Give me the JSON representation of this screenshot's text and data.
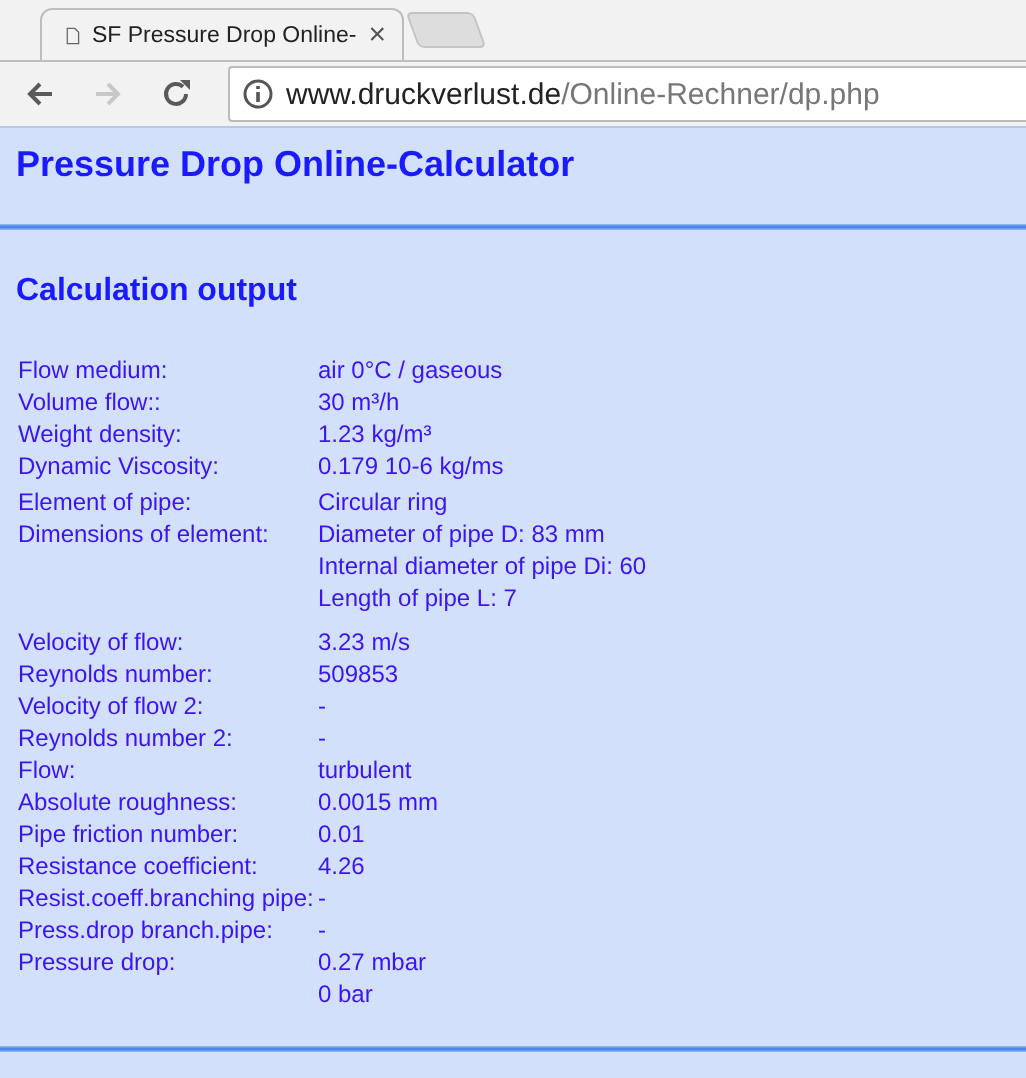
{
  "browser": {
    "tab_title": "SF Pressure Drop Online-",
    "tab_close": "×",
    "nav": [
      {
        "kind": "back",
        "disabled": false
      },
      {
        "kind": "forward",
        "disabled": true
      },
      {
        "kind": "reload",
        "disabled": false
      }
    ],
    "url_host": "www.druckverlust.de",
    "url_path": "/Online-Rechner/dp.php"
  },
  "page": {
    "title": "Pressure Drop Online-Calculator",
    "heading": "Calculation output",
    "groups": [
      {
        "rows": [
          {
            "label": "Flow medium:",
            "values": [
              "air 0°C / gaseous"
            ]
          },
          {
            "label": "Volume flow::",
            "values": [
              "30 m³/h"
            ]
          },
          {
            "label": "Weight density:",
            "values": [
              "1.23 kg/m³"
            ]
          },
          {
            "label": "Dynamic Viscosity:",
            "values": [
              "0.179 10-6 kg/ms"
            ]
          }
        ]
      },
      {
        "rows": [
          {
            "label": "Element of pipe:",
            "values": [
              "Circular ring"
            ]
          },
          {
            "label": "Dimensions of element:",
            "values": [
              "Diameter of pipe D: 83 mm",
              "Internal diameter of pipe Di: 60",
              "Length of pipe L: 7"
            ]
          }
        ]
      },
      {
        "rows": [
          {
            "label": "Velocity of flow:",
            "values": [
              "3.23 m/s"
            ]
          },
          {
            "label": "Reynolds number:",
            "values": [
              "509853"
            ]
          },
          {
            "label": "Velocity of flow 2:",
            "values": [
              "-"
            ]
          },
          {
            "label": "Reynolds number 2:",
            "values": [
              "-"
            ]
          },
          {
            "label": "Flow:",
            "values": [
              "turbulent"
            ]
          },
          {
            "label": "Absolute roughness:",
            "values": [
              "0.0015 mm"
            ]
          },
          {
            "label": "Pipe friction number:",
            "values": [
              "0.01"
            ]
          },
          {
            "label": "Resistance coefficient:",
            "values": [
              "4.26"
            ]
          },
          {
            "label": "Resist.coeff.branching pipe:",
            "values": [
              "-"
            ]
          },
          {
            "label": "Press.drop branch.pipe:",
            "values": [
              "-"
            ]
          },
          {
            "label": "Pressure drop:",
            "values": [
              "0.27 mbar",
              "0 bar"
            ]
          }
        ]
      }
    ]
  }
}
